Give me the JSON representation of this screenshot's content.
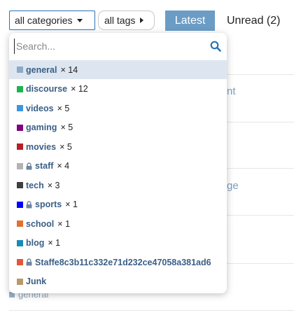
{
  "nav": {
    "categories_label": "all categories",
    "tags_label": "all tags",
    "latest_label": "Latest",
    "unread_label": "Unread (2)"
  },
  "background": {
    "row1_text": "nt",
    "row2_text": "ge",
    "row_category": "general"
  },
  "dropdown": {
    "search_placeholder": "Search...",
    "items": [
      {
        "name": "general",
        "count": "× 14",
        "color": "#8fa9c5",
        "locked": false
      },
      {
        "name": "discourse",
        "count": "× 12",
        "color": "#1db34f",
        "locked": false
      },
      {
        "name": "videos",
        "count": "× 5",
        "color": "#3c97e0",
        "locked": false
      },
      {
        "name": "gaming",
        "count": "× 5",
        "color": "#800080",
        "locked": false
      },
      {
        "name": "movies",
        "count": "× 5",
        "color": "#b32025",
        "locked": false
      },
      {
        "name": "staff",
        "count": "× 4",
        "color": "#b3b3b3",
        "locked": true
      },
      {
        "name": "tech",
        "count": "× 3",
        "color": "#3f3f3f",
        "locked": false
      },
      {
        "name": "sports",
        "count": "× 1",
        "color": "#0000ff",
        "locked": true
      },
      {
        "name": "school",
        "count": "× 1",
        "color": "#e3702b",
        "locked": false
      },
      {
        "name": "blog",
        "count": "× 1",
        "color": "#1b8ab8",
        "locked": false
      },
      {
        "name": "Staffe8c3b11c332e71d232ce47058a381ad6",
        "count": "",
        "color": "#e45735",
        "locked": true
      },
      {
        "name": "Junk",
        "count": "",
        "color": "#b7996b",
        "locked": false
      }
    ]
  }
}
